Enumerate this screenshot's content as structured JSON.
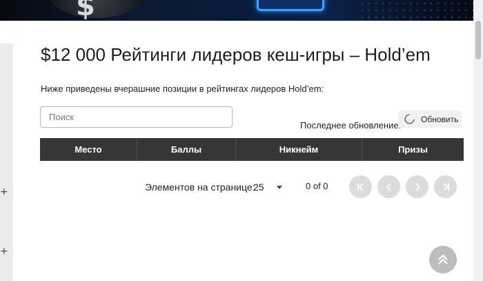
{
  "page": {
    "title": "$12 000 Рейтинги лидеров кеш-игры – Hold’em",
    "subtitle": "Ниже приведены вчерашние позиции в рейтингах лидеров Hold’em:"
  },
  "search": {
    "placeholder": "Поиск",
    "value": ""
  },
  "update": {
    "label": "Последнее обновление:",
    "refresh_label": "Обновить"
  },
  "table": {
    "columns": [
      "Место",
      "Баллы",
      "Никнейм",
      "Призы"
    ],
    "rows": []
  },
  "pagination": {
    "per_page_label": "Элементов на странице:",
    "per_page_value": "25",
    "range": "0 of 0"
  },
  "sidebar": {
    "expand_symbols": [
      "+",
      "+"
    ]
  },
  "colors": {
    "header_bg": "#363636",
    "pager_button": "#dcdcdc",
    "scroll_top_button": "#bdbdbd"
  },
  "icons": [
    "refresh-icon",
    "chevron-down-icon",
    "first-page-icon",
    "prev-page-icon",
    "next-page-icon",
    "last-page-icon",
    "scroll-top-icon"
  ]
}
